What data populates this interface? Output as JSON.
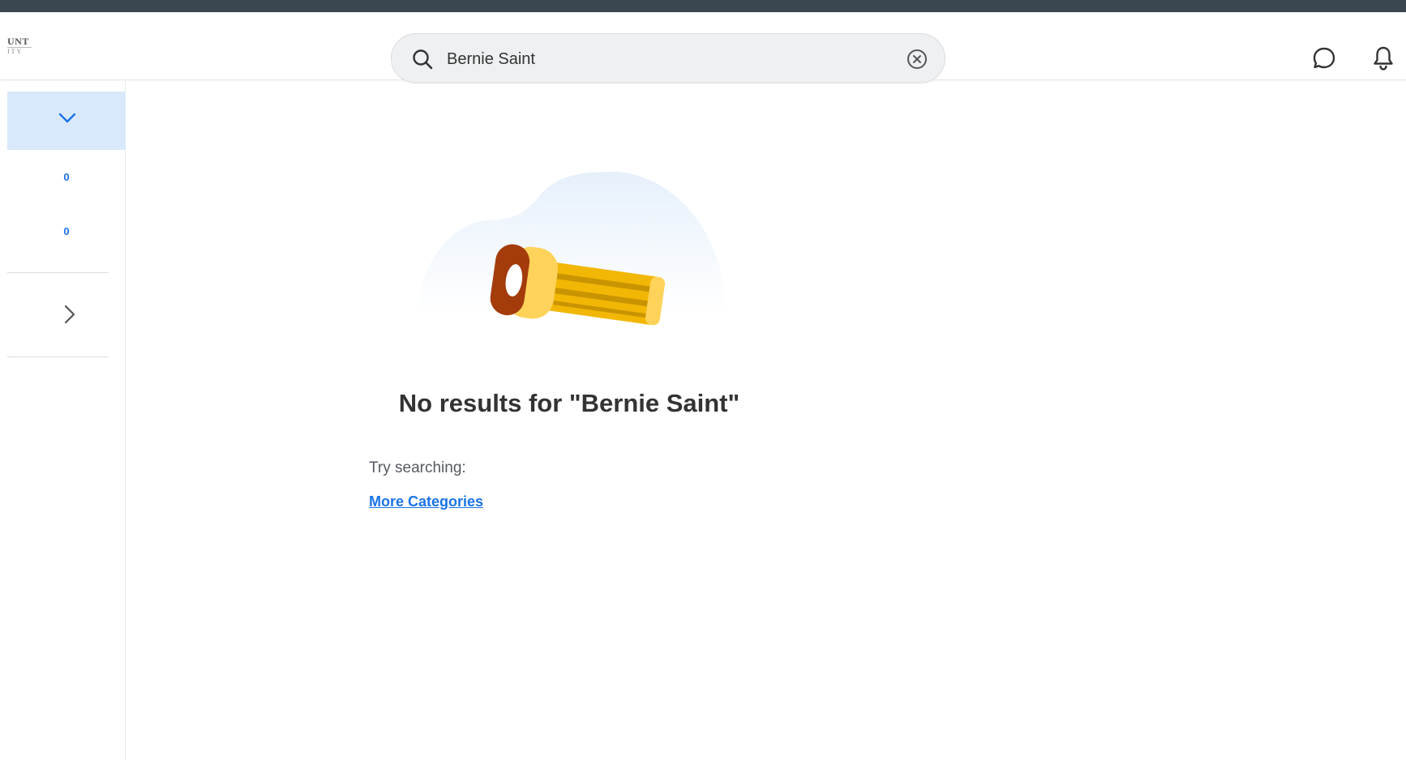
{
  "app": {
    "logo_line1": "UNT",
    "logo_line2": "ITY"
  },
  "search": {
    "value": "Bernie Saint",
    "placeholder": "Search"
  },
  "header": {
    "icons": [
      "search-icon",
      "clear-icon",
      "chat-icon",
      "bell-icon"
    ]
  },
  "sidebar": {
    "counts": [
      "0",
      "0"
    ],
    "icons": [
      "chevron-down-icon",
      "chevron-right-icon"
    ]
  },
  "results": {
    "title": "No results for \"Bernie Saint\"",
    "hint": "Try searching:",
    "link": "More Categories"
  },
  "colors": {
    "accent": "#1a73e8",
    "selected_bg": "#d9e9fb",
    "top_strip": "#3a4750",
    "flashlight_body": "#f2b705",
    "flashlight_cap": "#a33b0b"
  }
}
